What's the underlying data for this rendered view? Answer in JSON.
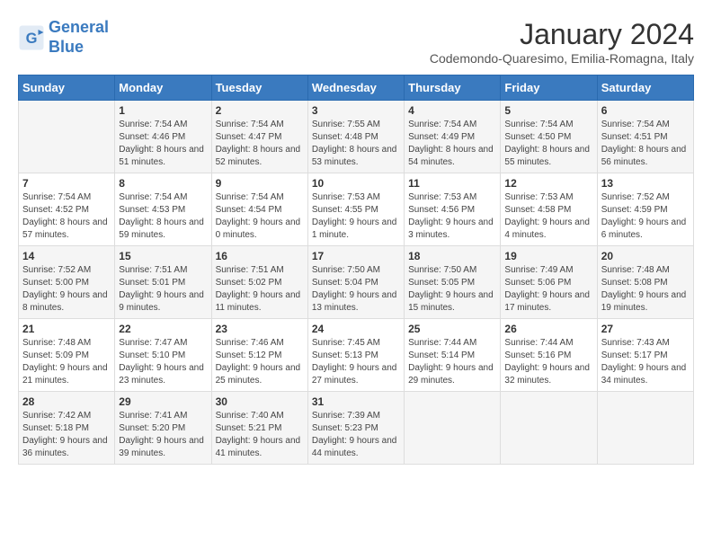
{
  "header": {
    "logo_line1": "General",
    "logo_line2": "Blue",
    "month_title": "January 2024",
    "location": "Codemondo-Quaresimo, Emilia-Romagna, Italy"
  },
  "weekdays": [
    "Sunday",
    "Monday",
    "Tuesday",
    "Wednesday",
    "Thursday",
    "Friday",
    "Saturday"
  ],
  "weeks": [
    [
      {
        "day": "",
        "sunrise": "",
        "sunset": "",
        "daylight": ""
      },
      {
        "day": "1",
        "sunrise": "Sunrise: 7:54 AM",
        "sunset": "Sunset: 4:46 PM",
        "daylight": "Daylight: 8 hours and 51 minutes."
      },
      {
        "day": "2",
        "sunrise": "Sunrise: 7:54 AM",
        "sunset": "Sunset: 4:47 PM",
        "daylight": "Daylight: 8 hours and 52 minutes."
      },
      {
        "day": "3",
        "sunrise": "Sunrise: 7:55 AM",
        "sunset": "Sunset: 4:48 PM",
        "daylight": "Daylight: 8 hours and 53 minutes."
      },
      {
        "day": "4",
        "sunrise": "Sunrise: 7:54 AM",
        "sunset": "Sunset: 4:49 PM",
        "daylight": "Daylight: 8 hours and 54 minutes."
      },
      {
        "day": "5",
        "sunrise": "Sunrise: 7:54 AM",
        "sunset": "Sunset: 4:50 PM",
        "daylight": "Daylight: 8 hours and 55 minutes."
      },
      {
        "day": "6",
        "sunrise": "Sunrise: 7:54 AM",
        "sunset": "Sunset: 4:51 PM",
        "daylight": "Daylight: 8 hours and 56 minutes."
      }
    ],
    [
      {
        "day": "7",
        "sunrise": "Sunrise: 7:54 AM",
        "sunset": "Sunset: 4:52 PM",
        "daylight": "Daylight: 8 hours and 57 minutes."
      },
      {
        "day": "8",
        "sunrise": "Sunrise: 7:54 AM",
        "sunset": "Sunset: 4:53 PM",
        "daylight": "Daylight: 8 hours and 59 minutes."
      },
      {
        "day": "9",
        "sunrise": "Sunrise: 7:54 AM",
        "sunset": "Sunset: 4:54 PM",
        "daylight": "Daylight: 9 hours and 0 minutes."
      },
      {
        "day": "10",
        "sunrise": "Sunrise: 7:53 AM",
        "sunset": "Sunset: 4:55 PM",
        "daylight": "Daylight: 9 hours and 1 minute."
      },
      {
        "day": "11",
        "sunrise": "Sunrise: 7:53 AM",
        "sunset": "Sunset: 4:56 PM",
        "daylight": "Daylight: 9 hours and 3 minutes."
      },
      {
        "day": "12",
        "sunrise": "Sunrise: 7:53 AM",
        "sunset": "Sunset: 4:58 PM",
        "daylight": "Daylight: 9 hours and 4 minutes."
      },
      {
        "day": "13",
        "sunrise": "Sunrise: 7:52 AM",
        "sunset": "Sunset: 4:59 PM",
        "daylight": "Daylight: 9 hours and 6 minutes."
      }
    ],
    [
      {
        "day": "14",
        "sunrise": "Sunrise: 7:52 AM",
        "sunset": "Sunset: 5:00 PM",
        "daylight": "Daylight: 9 hours and 8 minutes."
      },
      {
        "day": "15",
        "sunrise": "Sunrise: 7:51 AM",
        "sunset": "Sunset: 5:01 PM",
        "daylight": "Daylight: 9 hours and 9 minutes."
      },
      {
        "day": "16",
        "sunrise": "Sunrise: 7:51 AM",
        "sunset": "Sunset: 5:02 PM",
        "daylight": "Daylight: 9 hours and 11 minutes."
      },
      {
        "day": "17",
        "sunrise": "Sunrise: 7:50 AM",
        "sunset": "Sunset: 5:04 PM",
        "daylight": "Daylight: 9 hours and 13 minutes."
      },
      {
        "day": "18",
        "sunrise": "Sunrise: 7:50 AM",
        "sunset": "Sunset: 5:05 PM",
        "daylight": "Daylight: 9 hours and 15 minutes."
      },
      {
        "day": "19",
        "sunrise": "Sunrise: 7:49 AM",
        "sunset": "Sunset: 5:06 PM",
        "daylight": "Daylight: 9 hours and 17 minutes."
      },
      {
        "day": "20",
        "sunrise": "Sunrise: 7:48 AM",
        "sunset": "Sunset: 5:08 PM",
        "daylight": "Daylight: 9 hours and 19 minutes."
      }
    ],
    [
      {
        "day": "21",
        "sunrise": "Sunrise: 7:48 AM",
        "sunset": "Sunset: 5:09 PM",
        "daylight": "Daylight: 9 hours and 21 minutes."
      },
      {
        "day": "22",
        "sunrise": "Sunrise: 7:47 AM",
        "sunset": "Sunset: 5:10 PM",
        "daylight": "Daylight: 9 hours and 23 minutes."
      },
      {
        "day": "23",
        "sunrise": "Sunrise: 7:46 AM",
        "sunset": "Sunset: 5:12 PM",
        "daylight": "Daylight: 9 hours and 25 minutes."
      },
      {
        "day": "24",
        "sunrise": "Sunrise: 7:45 AM",
        "sunset": "Sunset: 5:13 PM",
        "daylight": "Daylight: 9 hours and 27 minutes."
      },
      {
        "day": "25",
        "sunrise": "Sunrise: 7:44 AM",
        "sunset": "Sunset: 5:14 PM",
        "daylight": "Daylight: 9 hours and 29 minutes."
      },
      {
        "day": "26",
        "sunrise": "Sunrise: 7:44 AM",
        "sunset": "Sunset: 5:16 PM",
        "daylight": "Daylight: 9 hours and 32 minutes."
      },
      {
        "day": "27",
        "sunrise": "Sunrise: 7:43 AM",
        "sunset": "Sunset: 5:17 PM",
        "daylight": "Daylight: 9 hours and 34 minutes."
      }
    ],
    [
      {
        "day": "28",
        "sunrise": "Sunrise: 7:42 AM",
        "sunset": "Sunset: 5:18 PM",
        "daylight": "Daylight: 9 hours and 36 minutes."
      },
      {
        "day": "29",
        "sunrise": "Sunrise: 7:41 AM",
        "sunset": "Sunset: 5:20 PM",
        "daylight": "Daylight: 9 hours and 39 minutes."
      },
      {
        "day": "30",
        "sunrise": "Sunrise: 7:40 AM",
        "sunset": "Sunset: 5:21 PM",
        "daylight": "Daylight: 9 hours and 41 minutes."
      },
      {
        "day": "31",
        "sunrise": "Sunrise: 7:39 AM",
        "sunset": "Sunset: 5:23 PM",
        "daylight": "Daylight: 9 hours and 44 minutes."
      },
      {
        "day": "",
        "sunrise": "",
        "sunset": "",
        "daylight": ""
      },
      {
        "day": "",
        "sunrise": "",
        "sunset": "",
        "daylight": ""
      },
      {
        "day": "",
        "sunrise": "",
        "sunset": "",
        "daylight": ""
      }
    ]
  ]
}
